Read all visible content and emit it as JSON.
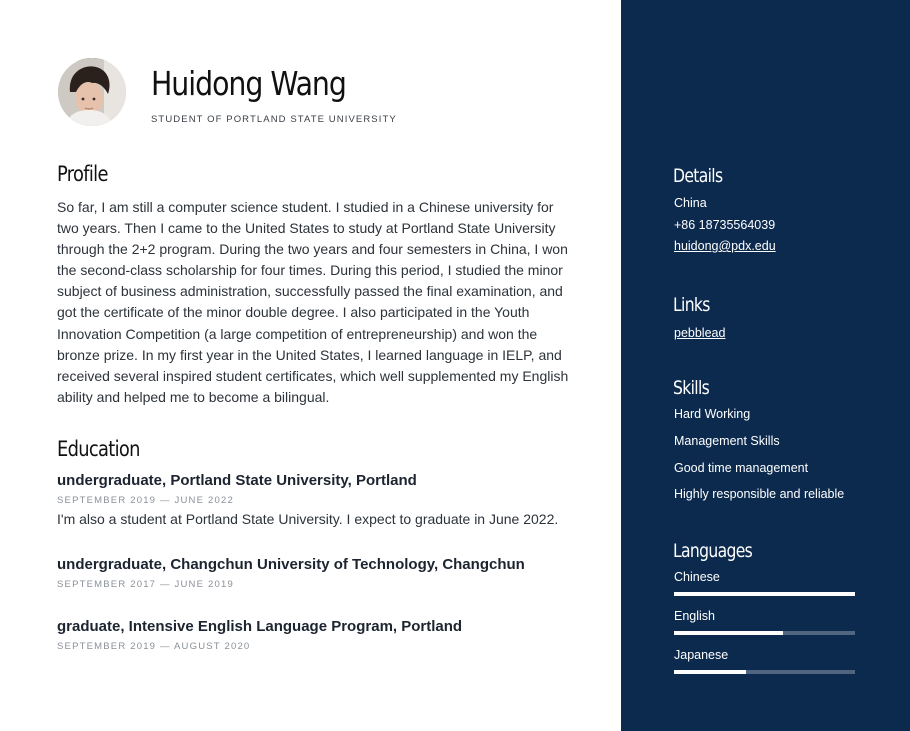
{
  "header": {
    "name": "Huidong Wang",
    "subtitle": "STUDENT OF PORTLAND STATE UNIVERSITY"
  },
  "profile": {
    "title": "Profile",
    "text": "So far, I am still a computer science student. I studied in a Chinese university for two years. Then I came to the United States to study at Portland State University through the 2+2 program. During the two years and four semesters in China, I won the second-class scholarship for four times. During this period, I studied the minor subject of business administration, successfully passed the final examination, and got the certificate of the minor double degree. I also participated in the Youth Innovation Competition (a large competition of entrepreneurship) and won the bronze prize. In my first year in the United States, I learned language in IELP, and received several inspired student certificates, which well supplemented my English ability and helped me to become a bilingual."
  },
  "education": {
    "title": "Education",
    "items": [
      {
        "title": "undergraduate, Portland State University, Portland",
        "dates": "SEPTEMBER 2019 — JUNE 2022",
        "description": "I'm also a student at Portland State University. I expect to graduate in June 2022."
      },
      {
        "title": "undergraduate, Changchun University of Technology, Changchun",
        "dates": "SEPTEMBER 2017 — JUNE 2019",
        "description": ""
      },
      {
        "title": "graduate, Intensive English Language Program, Portland",
        "dates": "SEPTEMBER 2019 — AUGUST 2020",
        "description": ""
      }
    ]
  },
  "sidebar": {
    "background_color": "#0c2a4e",
    "details": {
      "title": "Details",
      "country": "China",
      "phone": "+86 18735564039",
      "email": "huidong@pdx.edu"
    },
    "links": {
      "title": "Links",
      "items": [
        "pebblead"
      ]
    },
    "skills": {
      "title": "Skills",
      "items": [
        "Hard Working",
        "Management Skills",
        "Good time management",
        "Highly responsible and reliable"
      ]
    },
    "languages": {
      "title": "Languages",
      "items": [
        {
          "name": "Chinese",
          "level": 1.0
        },
        {
          "name": "English",
          "level": 0.6
        },
        {
          "name": "Japanese",
          "level": 0.4
        }
      ]
    }
  }
}
